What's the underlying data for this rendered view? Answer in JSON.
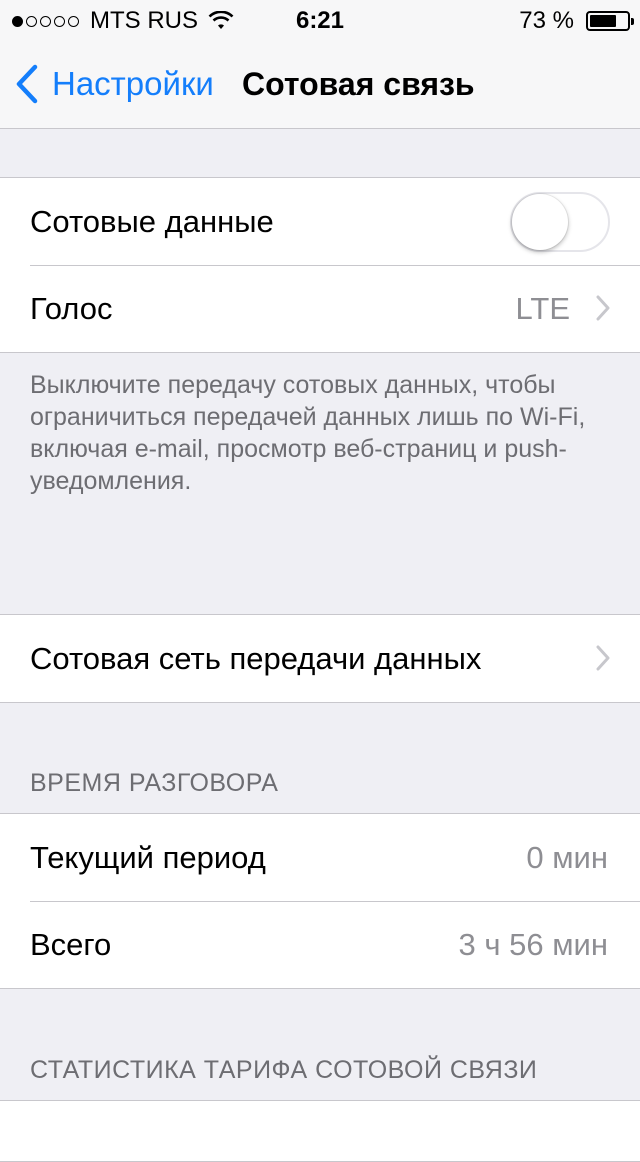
{
  "status_bar": {
    "signal_bars": 1,
    "carrier": "MTS RUS",
    "wifi_icon": "wifi-icon",
    "time": "6:21",
    "battery_text": "73 %",
    "battery_level": 0.73
  },
  "nav": {
    "back_label": "Настройки",
    "title": "Сотовая связь"
  },
  "group1": {
    "cellular_data_label": "Сотовые данные",
    "cellular_data_on": false,
    "voice_label": "Голос",
    "voice_value": "LTE"
  },
  "note": "Выключите передачу сотовых данных, чтобы ограничиться передачей данных лишь по Wi-Fi, включая e-mail, просмотр веб-страниц и push-уведомления.",
  "group2": {
    "data_network_label": "Сотовая сеть передачи данных"
  },
  "call_time": {
    "header": "ВРЕМЯ РАЗГОВОРА",
    "current_label": "Текущий период",
    "current_value": "0 мин",
    "total_label": "Всего",
    "total_value": "3 ч 56 мин"
  },
  "stats": {
    "header": "СТАТИСТИКА ТАРИФА СОТОВОЙ СВЯЗИ"
  },
  "colors": {
    "accent": "#147efb",
    "background": "#efeff4",
    "secondary_text": "#8e8e93"
  }
}
